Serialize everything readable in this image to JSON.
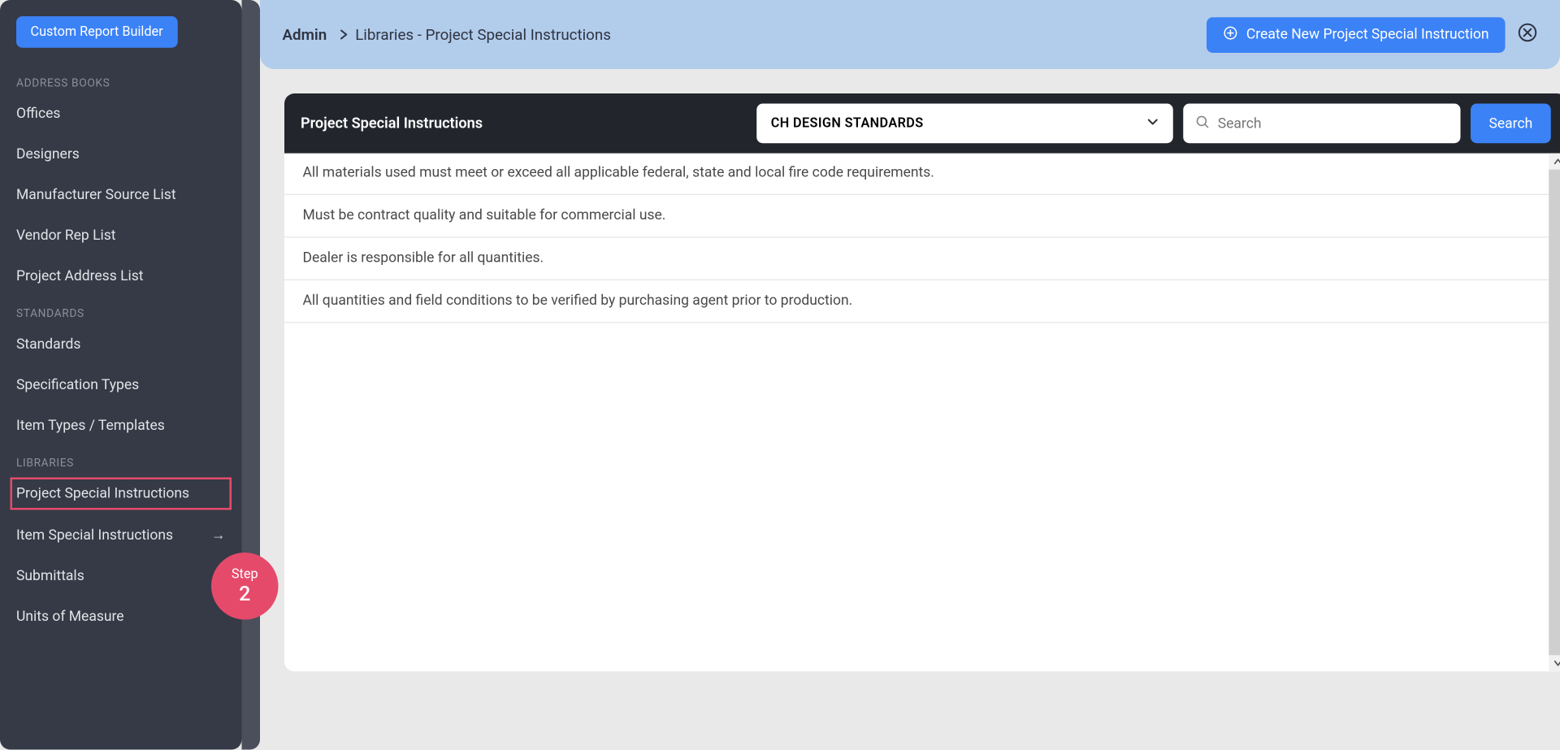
{
  "sidebar": {
    "custom_report_btn": "Custom Report Builder",
    "section1": "ADDRESS BOOKS",
    "items1": [
      "Offices",
      "Designers",
      "Manufacturer Source List",
      "Vendor Rep List",
      "Project Address List"
    ],
    "section2": "STANDARDS",
    "items2": [
      "Standards",
      "Specification Types",
      "Item Types / Templates"
    ],
    "section3": "LIBRARIES",
    "items3": [
      "Project Special Instructions",
      "Item Special Instructions",
      "Submittals",
      "Units of Measure"
    ]
  },
  "step": {
    "label": "Step",
    "number": "2"
  },
  "breadcrumb": {
    "admin": "Admin",
    "rest": "Libraries - Project Special Instructions"
  },
  "actions": {
    "create": "Create New Project Special Instruction"
  },
  "panel": {
    "title": "Project Special Instructions",
    "select_value": "CH DESIGN STANDARDS",
    "search_placeholder": "Search",
    "search_btn": "Search"
  },
  "rows": [
    "All materials used must meet or exceed all applicable federal, state and local fire code requirements.",
    "Must be contract quality and suitable for commercial use.",
    "Dealer is responsible for all quantities.",
    "All quantities and field conditions to be verified by purchasing agent prior to production."
  ]
}
